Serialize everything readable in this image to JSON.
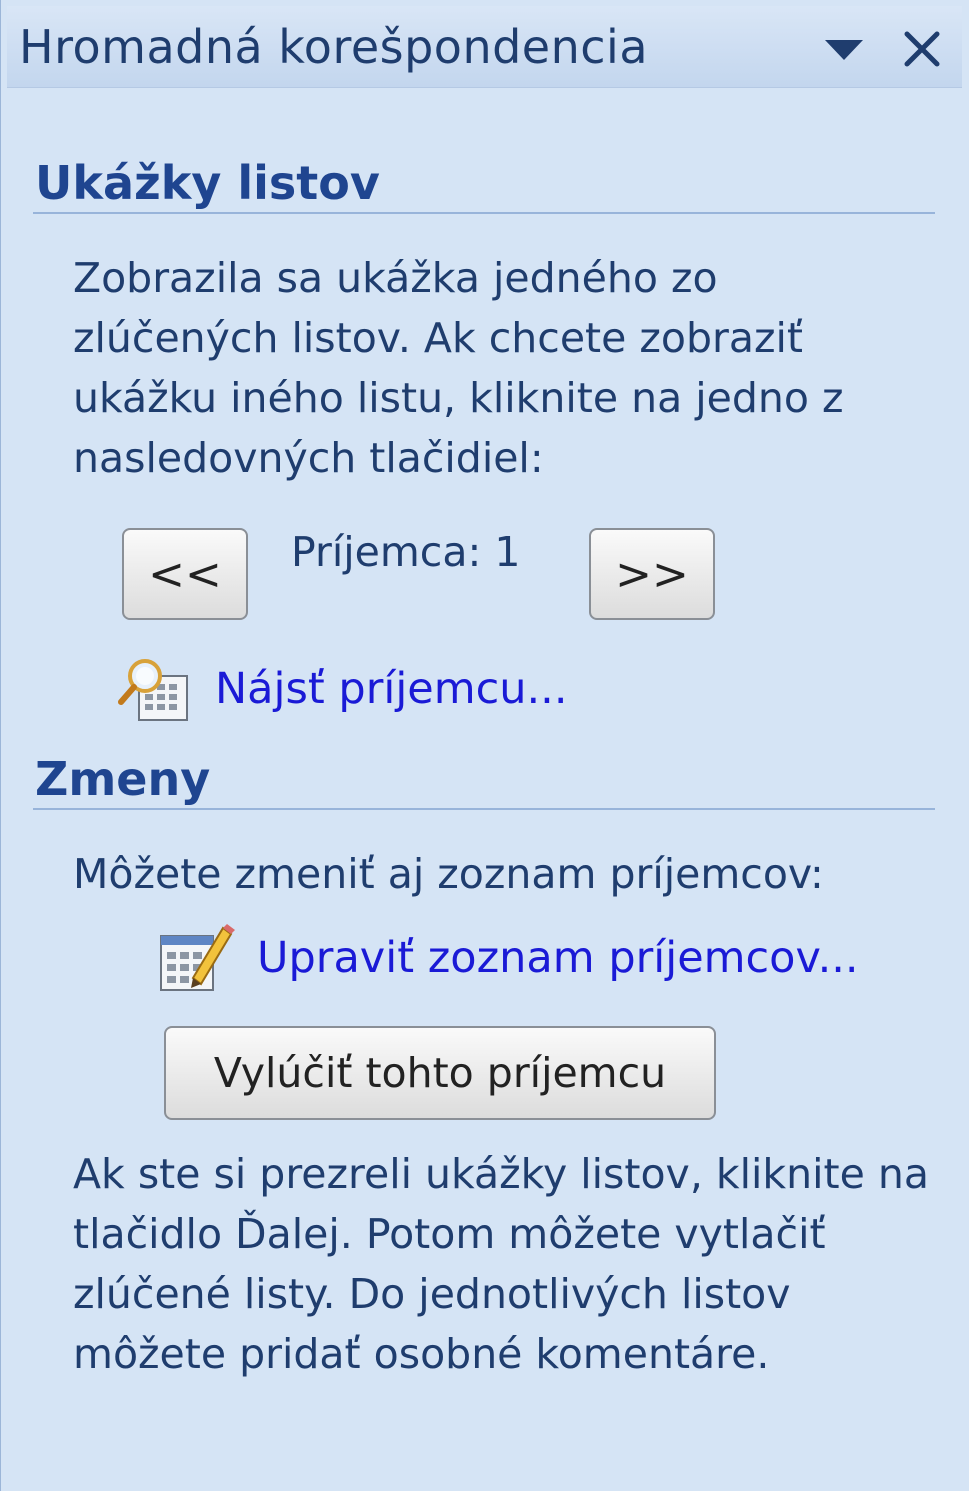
{
  "pane": {
    "title": "Hromadná korešpondencia"
  },
  "preview": {
    "heading": "Ukážky listov",
    "description": "Zobrazila sa ukážka jedného zo zlúčených listov. Ak chcete zobraziť ukážku iného listu, kliknite na jedno z nasledovných tlačidiel:",
    "prev_label": "<<",
    "next_label": ">>",
    "recipient_label": "Príjemca: 1",
    "find_link": "Nájsť príjemcu..."
  },
  "changes": {
    "heading": "Zmeny",
    "description": "Môžete zmeniť aj zoznam príjemcov:",
    "edit_link": "Upraviť zoznam príjemcov...",
    "exclude_button": "Vylúčiť tohto príjemcu",
    "footer_text": "Ak ste si prezreli ukážky listov, kliknite na tlačidlo Ďalej. Potom môžete vytlačiť zlúčené listy. Do jednotlivých listov môžete pridať osobné komentáre."
  },
  "icons": {
    "dropdown": "chevron-down-icon",
    "close": "close-icon",
    "find": "find-recipient-icon",
    "edit": "edit-list-icon"
  },
  "colors": {
    "pane_background": "#d5e4f5",
    "heading": "#1f4590",
    "link": "#1a1ad6",
    "rule": "#98b4da"
  }
}
